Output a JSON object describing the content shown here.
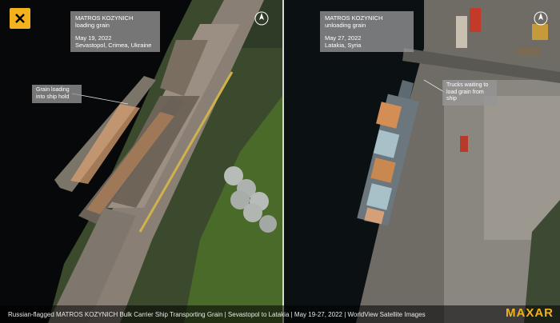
{
  "left_panel": {
    "title": "MATROS KOZYNICH",
    "subtitle": "loading grain",
    "date": "May 19, 2022",
    "location": "Sevastopol, Crimea, Ukraine",
    "callout": "Grain loading into ship hold"
  },
  "right_panel": {
    "title": "MATROS KOZYNICH",
    "subtitle": "unloading grain",
    "date": "May 27, 2022",
    "location": "Latakia, Syria",
    "callout": "Trucks waiting to load grain from ship"
  },
  "caption": "Russian-flagged MATROS KOZYNICH Bulk Carrier Ship Transporting Grain | Sevastopol to Latakia | May 19-27, 2022 | WorldView  Satellite Images",
  "logo": "MAXAR",
  "colors": {
    "brand": "#f3b11e",
    "label_bg": "#969696"
  },
  "icons": [
    "maxar-x-icon",
    "compass-icon"
  ]
}
